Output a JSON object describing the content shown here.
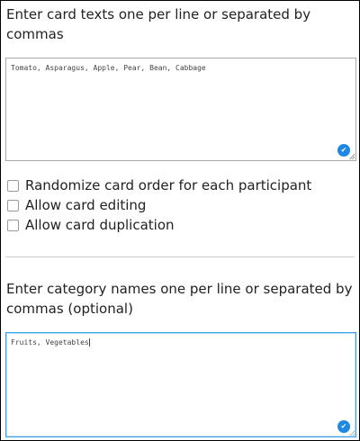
{
  "cards": {
    "label": "Enter card texts one per line or separated by commas",
    "value": "Tomato, Asparagus, Apple, Pear, Bean, Cabbage"
  },
  "options": [
    {
      "label": "Randomize card order for each participant",
      "checked": false
    },
    {
      "label": "Allow card editing",
      "checked": false
    },
    {
      "label": "Allow card duplication",
      "checked": false
    }
  ],
  "categories": {
    "label": "Enter category names one per line or separated by commas (optional)",
    "value": "Fruits, Vegetables"
  },
  "colors": {
    "accent": "#1e88e5",
    "focus_border": "#3a9ee8"
  }
}
